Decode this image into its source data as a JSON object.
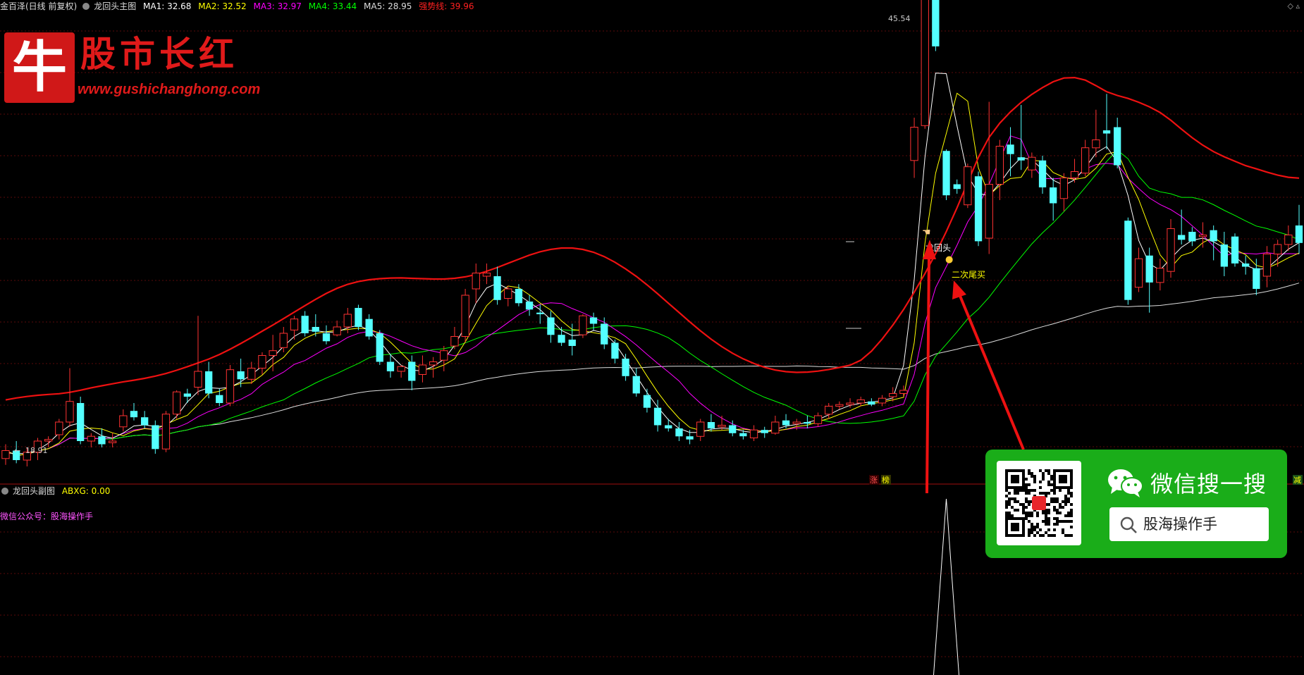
{
  "header": {
    "stock_name": "金百泽(日线 前复权)",
    "main_chart_title": "龙回头主图",
    "indicators": [
      {
        "label": "MA1: 32.68",
        "color": "#ffffff"
      },
      {
        "label": "MA2: 32.52",
        "color": "#ffff00"
      },
      {
        "label": "MA3: 32.97",
        "color": "#ff00ff"
      },
      {
        "label": "MA4: 33.44",
        "color": "#00ff00"
      },
      {
        "label": "MA5: 28.95",
        "color": "#dddddd"
      },
      {
        "label": "强势线: 39.96",
        "color": "#ff2020"
      }
    ]
  },
  "logo": {
    "icon_char": "牛",
    "title": "股市长红",
    "url": "www.gushichanghong.com"
  },
  "sub_header": {
    "title": "龙回头副图",
    "value_label": "ABXG: 0.00"
  },
  "note": "微信公众号：股海操作手",
  "ad": {
    "title": "微信搜一搜",
    "search_text": "股海操作手"
  },
  "chart_data": {
    "type": "candlestick",
    "price_labels": {
      "high": "45.54",
      "low": "18.91"
    },
    "annotations": {
      "dragon_head": "龙回头",
      "second_buy": "二次尾买",
      "zhang": "涨",
      "zhang_color": "#ff5050",
      "bang": "榜",
      "bang_color": "#ffff00",
      "right_marker": "减",
      "right_marker_color": "#ffff00"
    },
    "ohlc": [
      [
        19.5,
        20.4,
        19.1,
        20.0
      ],
      [
        20.0,
        20.6,
        19.2,
        19.4
      ],
      [
        19.4,
        20.2,
        19.0,
        19.9
      ],
      [
        19.9,
        20.8,
        19.4,
        20.6
      ],
      [
        20.6,
        20.9,
        20.2,
        20.7
      ],
      [
        21.0,
        22.0,
        20.7,
        21.8
      ],
      [
        21.8,
        25.2,
        21.5,
        23.1
      ],
      [
        23.0,
        23.4,
        20.4,
        20.6
      ],
      [
        20.6,
        21.1,
        20.2,
        20.9
      ],
      [
        20.9,
        21.4,
        20.2,
        20.4
      ],
      [
        20.5,
        21.1,
        20.2,
        20.6
      ],
      [
        21.5,
        22.6,
        21.2,
        22.2
      ],
      [
        22.5,
        23.0,
        21.9,
        22.1
      ],
      [
        22.1,
        22.5,
        21.4,
        21.6
      ],
      [
        21.6,
        21.9,
        19.8,
        20.1
      ],
      [
        20.1,
        22.5,
        19.9,
        22.3
      ],
      [
        22.3,
        23.8,
        22.0,
        23.7
      ],
      [
        23.6,
        23.9,
        23.0,
        23.4
      ],
      [
        24.0,
        28.5,
        23.5,
        25.0
      ],
      [
        25.0,
        25.6,
        23.3,
        23.6
      ],
      [
        23.5,
        23.9,
        22.8,
        23.0
      ],
      [
        23.0,
        25.4,
        22.8,
        25.1
      ],
      [
        25.0,
        25.8,
        24.0,
        24.5
      ],
      [
        24.5,
        25.6,
        24.2,
        25.2
      ],
      [
        25.2,
        26.2,
        24.8,
        26.0
      ],
      [
        26.0,
        27.3,
        25.0,
        26.3
      ],
      [
        26.5,
        27.8,
        26.2,
        27.4
      ],
      [
        27.6,
        28.5,
        27.0,
        28.3
      ],
      [
        28.5,
        28.8,
        27.2,
        27.4
      ],
      [
        27.8,
        28.6,
        27.2,
        27.5
      ],
      [
        27.4,
        27.9,
        26.7,
        26.9
      ],
      [
        27.3,
        28.2,
        27.2,
        27.8
      ],
      [
        27.8,
        29.0,
        27.4,
        28.6
      ],
      [
        29.0,
        29.2,
        27.6,
        27.8
      ],
      [
        28.3,
        28.6,
        27.0,
        27.2
      ],
      [
        27.4,
        27.6,
        25.4,
        25.6
      ],
      [
        25.6,
        26.1,
        24.6,
        25.0
      ],
      [
        25.0,
        25.4,
        24.6,
        25.3
      ],
      [
        25.6,
        26.0,
        23.8,
        24.4
      ],
      [
        24.8,
        26.0,
        24.3,
        25.4
      ],
      [
        25.4,
        25.9,
        24.6,
        25.6
      ],
      [
        25.7,
        26.6,
        25.0,
        26.3
      ],
      [
        26.6,
        27.8,
        26.4,
        27.2
      ],
      [
        27.2,
        30.2,
        26.8,
        29.8
      ],
      [
        30.2,
        31.8,
        29.3,
        31.2
      ],
      [
        31.0,
        31.8,
        30.5,
        31.2
      ],
      [
        31.0,
        31.6,
        29.2,
        29.5
      ],
      [
        29.6,
        30.4,
        29.1,
        30.2
      ],
      [
        30.2,
        30.5,
        29.1,
        29.3
      ],
      [
        29.4,
        29.8,
        28.5,
        28.9
      ],
      [
        28.7,
        29.2,
        28.0,
        28.6
      ],
      [
        28.4,
        28.8,
        26.8,
        27.3
      ],
      [
        27.3,
        27.8,
        26.6,
        26.8
      ],
      [
        27.0,
        28.0,
        26.0,
        26.6
      ],
      [
        27.3,
        28.6,
        27.1,
        28.5
      ],
      [
        28.4,
        28.7,
        27.6,
        28.0
      ],
      [
        28.0,
        28.4,
        26.4,
        26.7
      ],
      [
        26.8,
        27.0,
        25.5,
        25.8
      ],
      [
        25.8,
        26.1,
        24.4,
        24.7
      ],
      [
        24.7,
        25.2,
        23.4,
        23.6
      ],
      [
        23.5,
        23.9,
        22.4,
        22.7
      ],
      [
        22.7,
        23.2,
        21.2,
        21.6
      ],
      [
        21.6,
        22.0,
        21.2,
        21.4
      ],
      [
        21.4,
        21.8,
        20.6,
        20.9
      ],
      [
        20.9,
        21.3,
        20.4,
        20.7
      ],
      [
        20.9,
        22.0,
        20.6,
        21.8
      ],
      [
        21.8,
        22.3,
        21.2,
        21.4
      ],
      [
        21.5,
        22.2,
        21.3,
        21.6
      ],
      [
        21.6,
        21.9,
        20.9,
        21.1
      ],
      [
        21.1,
        21.3,
        20.7,
        20.9
      ],
      [
        20.8,
        21.6,
        20.6,
        21.3
      ],
      [
        21.3,
        21.5,
        20.8,
        21.1
      ],
      [
        21.1,
        22.2,
        21.0,
        21.8
      ],
      [
        21.9,
        22.3,
        21.4,
        21.6
      ],
      [
        21.7,
        22.0,
        21.3,
        21.8
      ],
      [
        21.8,
        22.2,
        21.4,
        21.7
      ],
      [
        21.7,
        22.4,
        21.5,
        22.2
      ],
      [
        22.3,
        23.0,
        22.0,
        22.8
      ],
      [
        22.8,
        23.1,
        22.6,
        22.9
      ],
      [
        22.9,
        23.3,
        22.7,
        23.0
      ],
      [
        23.0,
        23.4,
        22.8,
        23.2
      ],
      [
        23.1,
        23.3,
        22.8,
        22.9
      ],
      [
        23.0,
        23.5,
        22.8,
        23.3
      ],
      [
        23.4,
        24.0,
        23.1,
        23.6
      ],
      [
        23.6,
        24.1,
        23.4,
        23.8
      ],
      [
        38.3,
        41.0,
        37.2,
        40.4
      ],
      [
        40.5,
        55.5,
        40.3,
        54.2
      ],
      [
        54.8,
        55.2,
        45.2,
        45.5
      ],
      [
        38.9,
        39.0,
        35.8,
        36.1
      ],
      [
        36.8,
        37.1,
        36.2,
        36.5
      ],
      [
        35.5,
        38.1,
        35.3,
        37.9
      ],
      [
        37.3,
        37.6,
        32.9,
        33.2
      ],
      [
        33.4,
        42.0,
        32.4,
        36.8
      ],
      [
        36.8,
        39.6,
        35.8,
        39.2
      ],
      [
        39.3,
        40.4,
        37.3,
        38.7
      ],
      [
        38.5,
        41.8,
        37.7,
        38.3
      ],
      [
        37.7,
        38.8,
        37.2,
        38.5
      ],
      [
        38.3,
        38.6,
        36.2,
        36.6
      ],
      [
        36.6,
        37.2,
        34.5,
        35.6
      ],
      [
        35.9,
        37.5,
        35.1,
        37.2
      ],
      [
        37.2,
        38.4,
        36.9,
        37.6
      ],
      [
        37.5,
        39.6,
        37.3,
        39.1
      ],
      [
        39.1,
        41.5,
        38.5,
        39.6
      ],
      [
        40.2,
        42.5,
        39.0,
        40.0
      ],
      [
        40.4,
        41.0,
        37.8,
        38.0
      ],
      [
        34.5,
        34.7,
        29.2,
        29.5
      ],
      [
        30.3,
        32.8,
        30.0,
        32.1
      ],
      [
        32.3,
        32.8,
        28.7,
        30.6
      ],
      [
        30.6,
        32.1,
        30.1,
        31.5
      ],
      [
        31.3,
        34.6,
        30.9,
        34.0
      ],
      [
        33.6,
        35.2,
        33.0,
        33.3
      ],
      [
        33.8,
        34.1,
        32.9,
        33.2
      ],
      [
        33.5,
        34.4,
        32.8,
        33.6
      ],
      [
        33.9,
        34.2,
        32.0,
        33.2
      ],
      [
        33.0,
        33.8,
        31.0,
        31.6
      ],
      [
        33.5,
        33.7,
        31.6,
        31.8
      ],
      [
        31.8,
        32.3,
        31.1,
        31.6
      ],
      [
        31.5,
        32.1,
        29.8,
        30.2
      ],
      [
        31.0,
        32.9,
        30.3,
        32.4
      ],
      [
        32.4,
        33.3,
        31.6,
        33.0
      ],
      [
        33.0,
        34.2,
        32.6,
        33.6
      ],
      [
        34.2,
        35.5,
        32.4,
        33.1
      ]
    ],
    "marker_index": 88,
    "xlabel": "",
    "ylabel": ""
  }
}
